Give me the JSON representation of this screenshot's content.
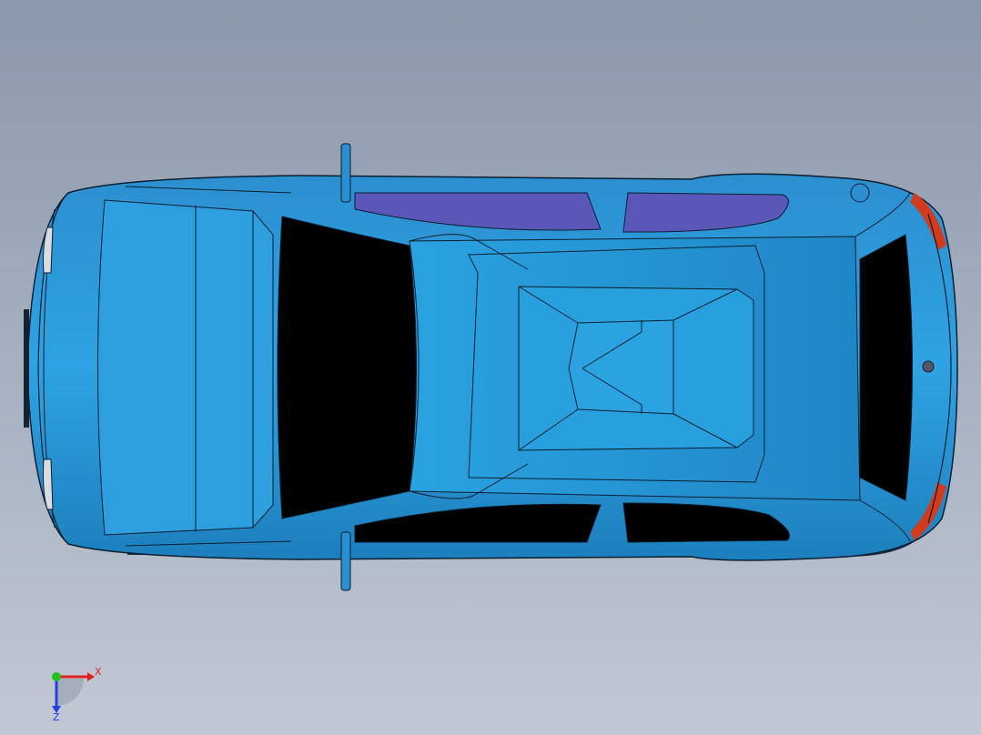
{
  "viewport": {
    "model": "car-body",
    "view": "top",
    "display_mode": "shaded-with-edges"
  },
  "colors": {
    "background_top": "#8a98ab",
    "background_bottom": "#c2c8d3",
    "body": "#2a9bd9",
    "body_dark": "#1a78b2",
    "edge": "#0a1e30",
    "glass": "#000000",
    "tinted_glass": "#5a57b8",
    "taillight": "#d23b1e",
    "x_axis": "#e02020",
    "y_axis": "#20c020",
    "z_axis": "#2040e0"
  },
  "triad": {
    "x_label": "X",
    "z_label": "Z"
  }
}
